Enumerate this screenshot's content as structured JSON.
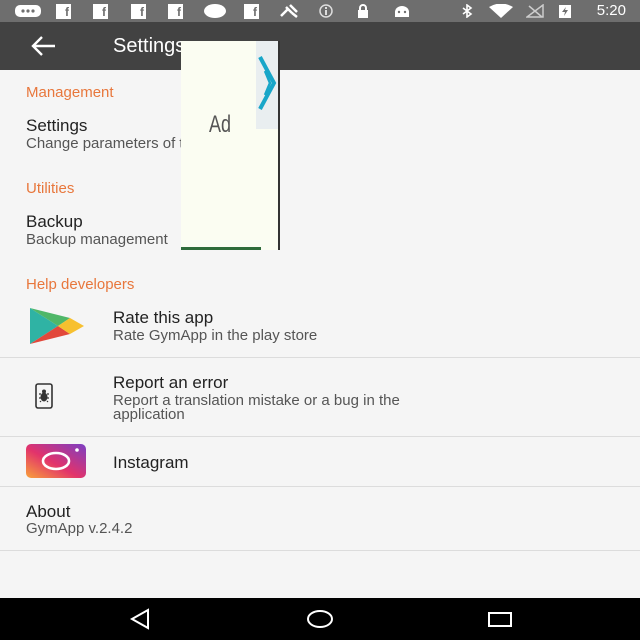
{
  "status_bar": {
    "time": "5:20",
    "left_icons": [
      "message-icon",
      "facebook-icon",
      "facebook-icon",
      "facebook-icon",
      "facebook-icon",
      "circle-icon",
      "facebook-icon",
      "satellite-icon",
      "info-icon",
      "lock-icon",
      "android-icon"
    ],
    "right_icons": [
      "bluetooth-icon",
      "wifi-icon",
      "no-signal-icon",
      "battery-charging-icon"
    ]
  },
  "app_bar": {
    "title": "Settings",
    "back_icon": "arrow-back-icon"
  },
  "ad": {
    "label": "Ad",
    "choices_icon": "ad-choices-icon"
  },
  "sections": {
    "management": "Management",
    "utilities": "Utilities",
    "help_developers": "Help developers"
  },
  "items": {
    "settings": {
      "title": "Settings",
      "subtitle": "Change parameters of the application"
    },
    "backup": {
      "title": "Backup",
      "subtitle": "Backup management"
    },
    "rate": {
      "title": "Rate this app",
      "subtitle": "Rate GymApp in the play store",
      "icon": "play-store-icon"
    },
    "report": {
      "title": "Report an error",
      "subtitle_line1": "Report a translation mistake or a bug in the",
      "subtitle_line2": "application",
      "icon": "bug-report-icon"
    },
    "instagram": {
      "title": "Instagram",
      "icon": "instagram-icon"
    },
    "about": {
      "title": "About",
      "subtitle": "GymApp v.2.4.2"
    }
  },
  "nav_bar": {
    "icons": [
      "back-triangle-icon",
      "home-circle-icon",
      "recents-square-icon"
    ]
  },
  "colors": {
    "accent": "#e8773c",
    "app_bar": "#424242",
    "status_bar": "#6e6e6e"
  }
}
